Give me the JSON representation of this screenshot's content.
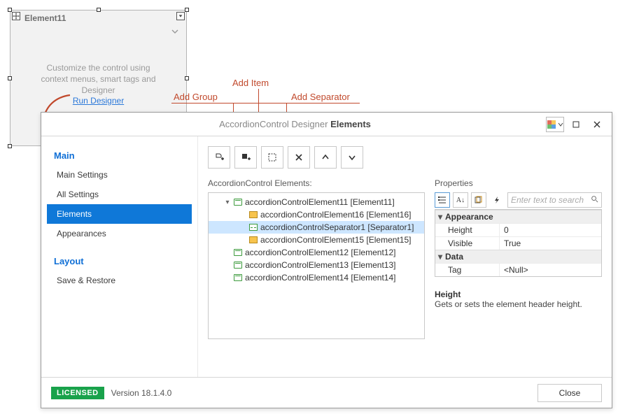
{
  "design_surface": {
    "element_title": "Element11",
    "hint_text": "Customize the control using\ncontext menus, smart tags and\nDesigner",
    "run_link": "Run Designer"
  },
  "annotations": {
    "add_group": "Add Group",
    "add_item": "Add Item",
    "add_separator": "Add Separator"
  },
  "designer": {
    "title_prefix": "AccordionControl Designer",
    "title_page": "Elements",
    "sidebar": {
      "section_main": "Main",
      "main_settings": "Main Settings",
      "all_settings": "All Settings",
      "elements": "Elements",
      "appearances": "Appearances",
      "section_layout": "Layout",
      "save_restore": "Save & Restore"
    },
    "toolbar": {
      "add_group": "Add Group",
      "add_item": "Add Item",
      "add_separator": "Add Separator",
      "remove": "Remove",
      "move_up": "Move Up",
      "move_down": "Move Down"
    },
    "tree": {
      "label": "AccordionControl Elements:",
      "rows": [
        {
          "indent": 0,
          "expander": "▾",
          "icon": "group",
          "text": "accordionControlElement11 [Element11]",
          "selected": false
        },
        {
          "indent": 1,
          "expander": "",
          "icon": "item",
          "text": "accordionControlElement16 [Element16]",
          "selected": false
        },
        {
          "indent": 1,
          "expander": "",
          "icon": "sep",
          "text": "accordionControlSeparator1 [Separator1]",
          "selected": true
        },
        {
          "indent": 1,
          "expander": "",
          "icon": "item",
          "text": "accordionControlElement15 [Element15]",
          "selected": false
        },
        {
          "indent": 0,
          "expander": "",
          "icon": "group",
          "text": "accordionControlElement12 [Element12]",
          "selected": false
        },
        {
          "indent": 0,
          "expander": "",
          "icon": "group",
          "text": "accordionControlElement13 [Element13]",
          "selected": false
        },
        {
          "indent": 0,
          "expander": "",
          "icon": "group",
          "text": "accordionControlElement14 [Element14]",
          "selected": false
        }
      ]
    },
    "properties": {
      "label": "Properties",
      "search_placeholder": "Enter text to search",
      "cat_appearance": "Appearance",
      "height_key": "Height",
      "height_val": "0",
      "visible_key": "Visible",
      "visible_val": "True",
      "cat_data": "Data",
      "tag_key": "Tag",
      "tag_val": "<Null>",
      "help_title": "Height",
      "help_desc": "Gets or sets the element header height."
    },
    "footer": {
      "license": "LICENSED",
      "version": "Version 18.1.4.0",
      "close": "Close"
    }
  }
}
